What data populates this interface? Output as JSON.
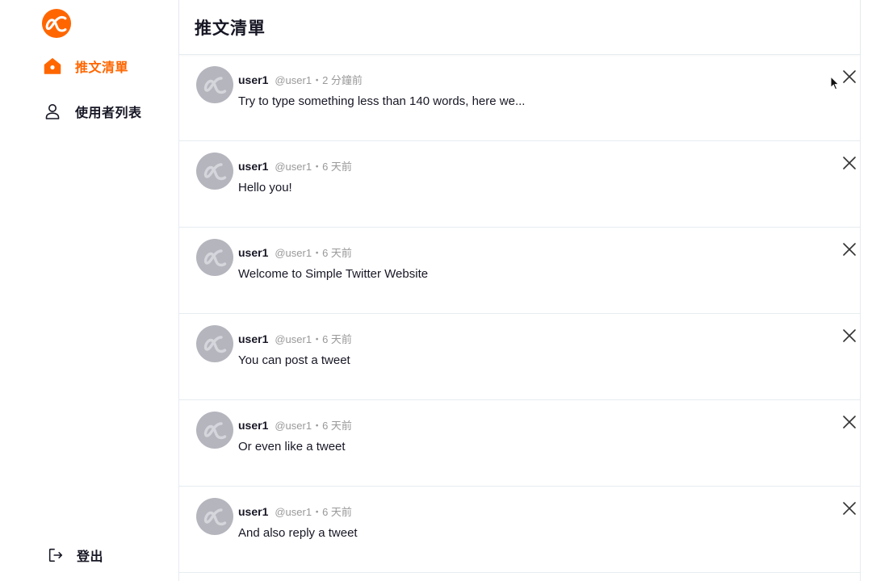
{
  "brand": {
    "accent_color": "#ff6600",
    "logo_icon": "alpha-logo-icon"
  },
  "sidebar": {
    "items": [
      {
        "label": "推文清單",
        "icon": "home-icon",
        "active": true
      },
      {
        "label": "使用者列表",
        "icon": "user-icon",
        "active": false
      }
    ],
    "logout_label": "登出",
    "logout_icon": "logout-icon"
  },
  "header": {
    "title": "推文清單"
  },
  "tweets": [
    {
      "name": "user1",
      "meta": "@user1・2 分鐘前",
      "text": "Try to type something less than 140 words, here we..."
    },
    {
      "name": "user1",
      "meta": "@user1・6 天前",
      "text": "Hello you!"
    },
    {
      "name": "user1",
      "meta": "@user1・6 天前",
      "text": "Welcome to Simple Twitter Website"
    },
    {
      "name": "user1",
      "meta": "@user1・6 天前",
      "text": "You can post a tweet"
    },
    {
      "name": "user1",
      "meta": "@user1・6 天前",
      "text": "Or even like a tweet"
    },
    {
      "name": "user1",
      "meta": "@user1・6 天前",
      "text": "And also reply a tweet"
    }
  ]
}
